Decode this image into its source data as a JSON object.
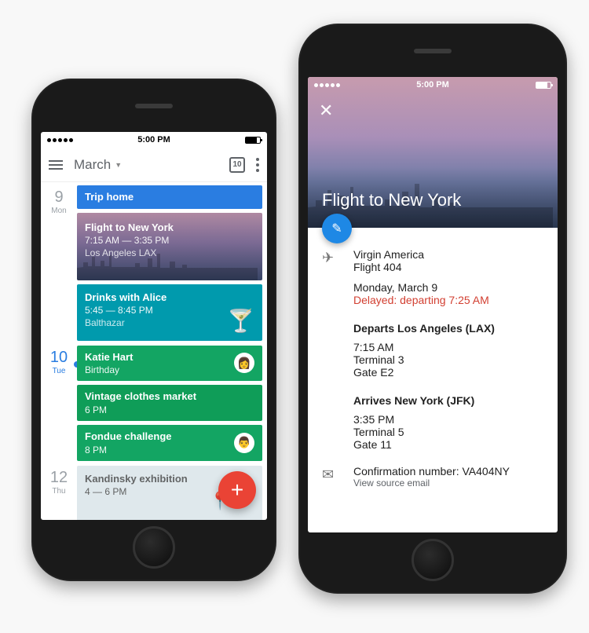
{
  "status_time": "5:00 PM",
  "calendar": {
    "month": "March",
    "today_badge": "10",
    "days": [
      {
        "num": "9",
        "dow": "Mon",
        "current": false,
        "events": [
          {
            "kind": "trip",
            "title": "Trip home"
          },
          {
            "kind": "flight",
            "title": "Flight to New York",
            "time": "7:15 AM — 3:35 PM",
            "location": "Los Angeles LAX"
          },
          {
            "kind": "drinks",
            "title": "Drinks with Alice",
            "time": "5:45 — 8:45 PM",
            "location": "Balthazar"
          }
        ]
      },
      {
        "num": "10",
        "dow": "Tue",
        "current": true,
        "events": [
          {
            "kind": "green",
            "title": "Katie Hart",
            "sub": "Birthday",
            "avatar": "👩"
          },
          {
            "kind": "green-teal",
            "title": "Vintage clothes market",
            "time": "6 PM"
          },
          {
            "kind": "green",
            "title": "Fondue challenge",
            "time": "8 PM",
            "avatar": "👨"
          }
        ]
      },
      {
        "num": "12",
        "dow": "Thu",
        "current": false,
        "events": [
          {
            "kind": "map",
            "title": "Kandinsky exhibition",
            "time": "4 — 6 PM"
          }
        ]
      }
    ]
  },
  "event": {
    "title": "Flight to New York",
    "airline": "Virgin America",
    "flight_no": "Flight 404",
    "date": "Monday, March 9",
    "delay": "Delayed: departing 7:25 AM",
    "depart": {
      "heading": "Departs Los Angeles (LAX)",
      "time": "7:15 AM",
      "terminal": "Terminal 3",
      "gate": "Gate E2"
    },
    "arrive": {
      "heading": "Arrives New York (JFK)",
      "time": "3:35 PM",
      "terminal": "Terminal 5",
      "gate": "Gate 11"
    },
    "confirmation": "Confirmation number: VA404NY",
    "source_link": "View source email"
  },
  "colors": {
    "blue": "#2a7de1",
    "teal": "#009aad",
    "green": "#13a563",
    "red": "#ea4335",
    "delay": "#d23f31"
  }
}
